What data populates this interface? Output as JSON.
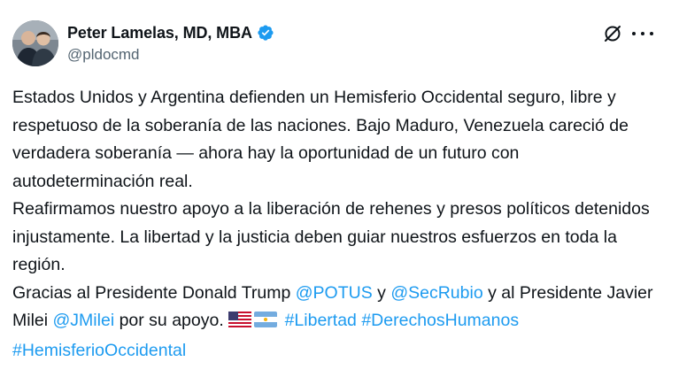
{
  "author": {
    "display_name": "Peter Lamelas, MD, MBA",
    "handle": "@pldocmd",
    "verified": true
  },
  "icons": {
    "grok": "grok-icon",
    "more": "more-icon",
    "verified": "verified-badge-icon"
  },
  "colors": {
    "link": "#1d9bf0",
    "text": "#0f1419",
    "secondary": "#536471"
  },
  "tweet": {
    "p1": "Estados Unidos y Argentina defienden un Hemisferio Occidental seguro, libre y respetuoso de la soberanía de las naciones. Bajo Maduro, Venezuela careció de verdadera soberanía — ahora hay la oportunidad de un futuro con autodeterminación real.",
    "p2": "Reafirmamos nuestro apoyo a la liberación de rehenes y presos políticos detenidos injustamente. La libertad y la justicia deben guiar nuestros esfuerzos en toda la región.",
    "p3_a": "Gracias al Presidente Donald Trump ",
    "mention_potus": "@POTUS",
    "p3_b": " y ",
    "mention_secrubio": "@SecRubio",
    "p3_c": " y al Presidente Javier Milei ",
    "mention_jmilei": "@JMilei",
    "p3_d": " por su apoyo. ",
    "flags": [
      "us-flag",
      "argentina-flag"
    ],
    "hashtag_libertad": "#Libertad",
    "hashtag_derechos": "#DerechosHumanos",
    "hashtag_hemisferio": "#HemisferioOccidental"
  }
}
